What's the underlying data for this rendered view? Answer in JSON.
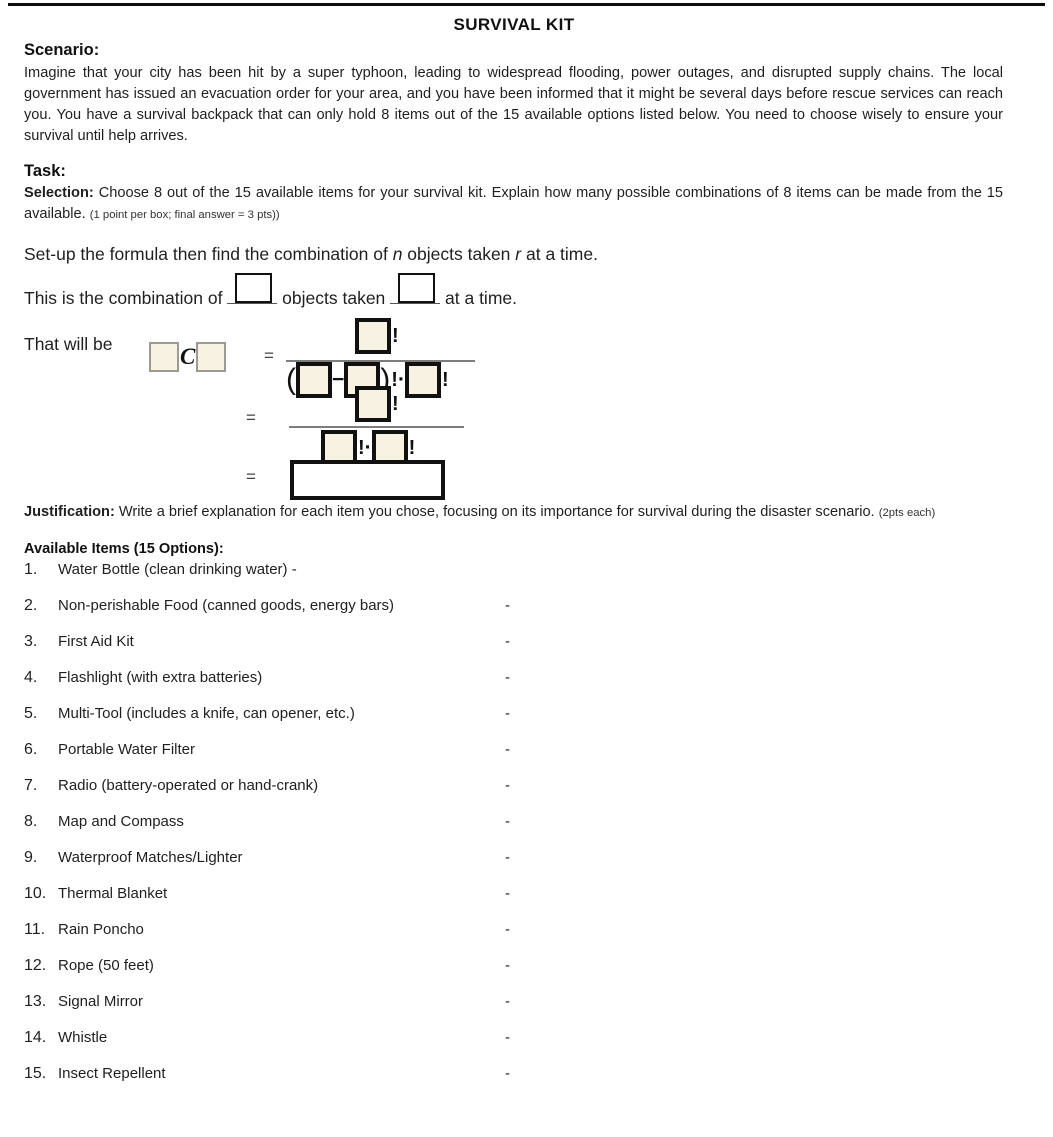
{
  "document": {
    "title": "SURVIVAL KIT"
  },
  "scenario": {
    "heading": "Scenario:",
    "body": "Imagine that your city has been hit by a super typhoon, leading to widespread flooding, power outages, and disrupted supply chains. The local government has issued an evacuation order for your area, and you have been informed that it might be several days before rescue services can reach you. You have a survival backpack that can only hold 8 items out of the 15 available options listed below. You need to choose wisely to ensure your survival until help arrives."
  },
  "task": {
    "heading": "Task:",
    "selection_label": "Selection:",
    "selection_body": "Choose 8 out of the 15 available items for your survival kit. Explain how many possible combinations of 8 items can be made from the 15 available.",
    "selection_points": "(1 point per box; final answer = 3 pts))",
    "setup_instruction_a": "Set-up the formula then find the combination of ",
    "setup_var_n": "n",
    "setup_instruction_b": " objects taken ",
    "setup_var_r": "r",
    "setup_instruction_c": " at a time.",
    "combination_a": "This is the combination of ",
    "combination_b": " objects taken ",
    "combination_c": " at a time.",
    "that_will_be": "That will be"
  },
  "formula": {
    "c_symbol": "C",
    "equals": "=",
    "factorial": "!",
    "minus": "−",
    "dot": "·",
    "paren_open": "(",
    "paren_close": ")",
    "line1_numerator": [
      "box"
    ],
    "line1_denominator": [
      "paren_open",
      "box",
      "minus",
      "box",
      "paren_close",
      "factorial",
      "dot",
      "box",
      "factorial"
    ],
    "line2_numerator": [
      "box",
      "factorial"
    ],
    "line2_denominator": [
      "box",
      "factorial",
      "dot",
      "box",
      "factorial"
    ],
    "line3_answer": ""
  },
  "justification": {
    "label": "Justification:",
    "body": "Write a brief explanation for each item you chose, focusing on its importance for survival during the disaster scenario.",
    "points": "(2pts each)"
  },
  "items": {
    "heading": "Available Items (15 Options):",
    "dash": "-",
    "list": [
      {
        "num": "1.",
        "label": "Water Bottle (clean drinking water) -",
        "trailing_dash": false
      },
      {
        "num": "2.",
        "label": "Non-perishable Food (canned goods, energy bars)",
        "trailing_dash": true
      },
      {
        "num": "3.",
        "label": "First Aid Kit",
        "trailing_dash": true
      },
      {
        "num": "4.",
        "label": "Flashlight (with extra batteries)",
        "trailing_dash": true
      },
      {
        "num": "5.",
        "label": "Multi-Tool (includes a knife, can opener, etc.)",
        "trailing_dash": true
      },
      {
        "num": "6.",
        "label": "Portable Water Filter",
        "trailing_dash": true
      },
      {
        "num": "7.",
        "label": "Radio (battery-operated or hand-crank)",
        "trailing_dash": true
      },
      {
        "num": "8.",
        "label": "Map and Compass",
        "trailing_dash": true
      },
      {
        "num": "9.",
        "label": "Waterproof Matches/Lighter",
        "trailing_dash": true
      },
      {
        "num": "10.",
        "label": "Thermal Blanket",
        "trailing_dash": true
      },
      {
        "num": "11.",
        "label": "Rain Poncho",
        "trailing_dash": true
      },
      {
        "num": "12.",
        "label": "Rope (50 feet)",
        "trailing_dash": true
      },
      {
        "num": "13.",
        "label": "Signal Mirror",
        "trailing_dash": true
      },
      {
        "num": "14.",
        "label": "Whistle",
        "trailing_dash": true
      },
      {
        "num": "15.",
        "label": "Insect Repellent",
        "trailing_dash": true
      }
    ]
  },
  "colors": {
    "box_fill": "#f7f2e2",
    "box_border_thin": "#9b9b94",
    "box_border_thick": "#111111",
    "frac_bar": "#7d7d7d",
    "text": "#1f1f1f"
  }
}
